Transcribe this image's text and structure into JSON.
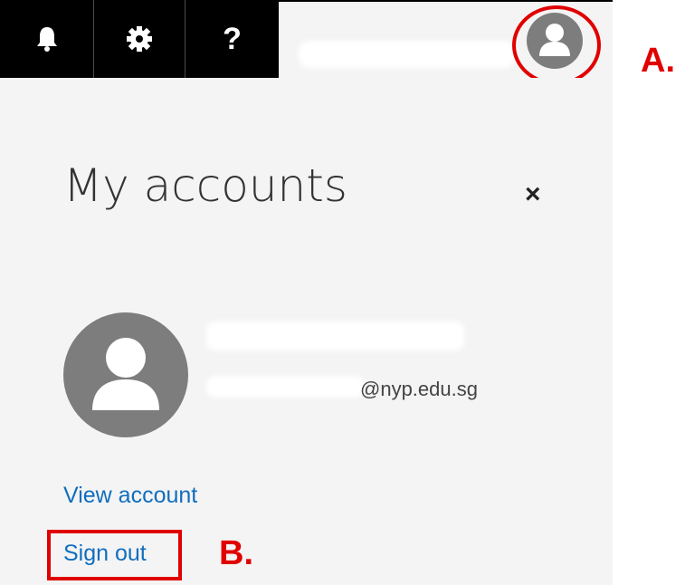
{
  "header": {
    "buttons": [
      {
        "icon": "bell-icon",
        "label": "Notifications"
      },
      {
        "icon": "gear-icon",
        "label": "Settings"
      },
      {
        "icon": "help-icon",
        "label": "?"
      }
    ],
    "annotation_a": "A."
  },
  "accounts_panel": {
    "title": "My accounts",
    "close_label": "×",
    "email_domain": "@nyp.edu.sg",
    "view_account": "View account",
    "sign_out": "Sign out",
    "annotation_b": "B."
  },
  "colors": {
    "topbar_bg": "#000000",
    "panel_bg": "#f4f4f4",
    "link": "#106ebe",
    "annotation": "#e00000",
    "avatar": "#7d7d7d"
  }
}
